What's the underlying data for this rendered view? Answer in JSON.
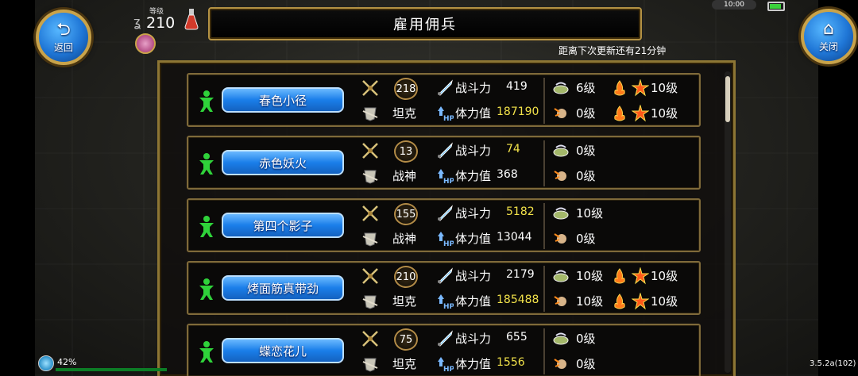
{
  "header": {
    "back_label": "返回",
    "close_label": "关闭",
    "level_label": "等级",
    "level_value": "210",
    "title": "雇用佣兵",
    "refresh_notice": "距离下次更新还有21分钟",
    "clock": "10:00"
  },
  "mercenaries": [
    {
      "name": "春色小径",
      "level": "218",
      "role": "坦克",
      "power_label": "战斗力",
      "power": "419",
      "hp_label": "体力值",
      "hp": "187190",
      "hp_highlight": true,
      "skills": [
        "6级",
        "0级"
      ],
      "extras": [
        "10级",
        "10级"
      ]
    },
    {
      "name": "赤色妖火",
      "level": "13",
      "role": "战神",
      "power_label": "战斗力",
      "power": "74",
      "power_highlight": true,
      "hp_label": "体力值",
      "hp": "368",
      "skills": [
        "0级",
        "0级"
      ],
      "extras": []
    },
    {
      "name": "第四个影子",
      "level": "155",
      "role": "战神",
      "power_label": "战斗力",
      "power": "5182",
      "power_highlight": true,
      "hp_label": "体力值",
      "hp": "13044",
      "skills": [
        "10级",
        "0级"
      ],
      "extras": []
    },
    {
      "name": "烤面筋真带劲",
      "level": "210",
      "role": "坦克",
      "power_label": "战斗力",
      "power": "2179",
      "hp_label": "体力值",
      "hp": "185488",
      "hp_highlight": true,
      "skills": [
        "10级",
        "10级"
      ],
      "extras": [
        "10级",
        "10级"
      ]
    },
    {
      "name": "蝶恋花儿",
      "level": "75",
      "role": "坦克",
      "power_label": "战斗力",
      "power": "655",
      "hp_label": "体力值",
      "hp": "1556",
      "hp_highlight": true,
      "skills": [
        "0级",
        "0级"
      ],
      "extras": []
    }
  ],
  "footer": {
    "battery_pct": "42%",
    "version": "3.5.2a(102)"
  },
  "colors": {
    "accent_gold": "#b49244",
    "button_blue": "#1a7ee9",
    "highlight_yellow": "#f2e24a",
    "merc_green": "#2fd23a"
  }
}
